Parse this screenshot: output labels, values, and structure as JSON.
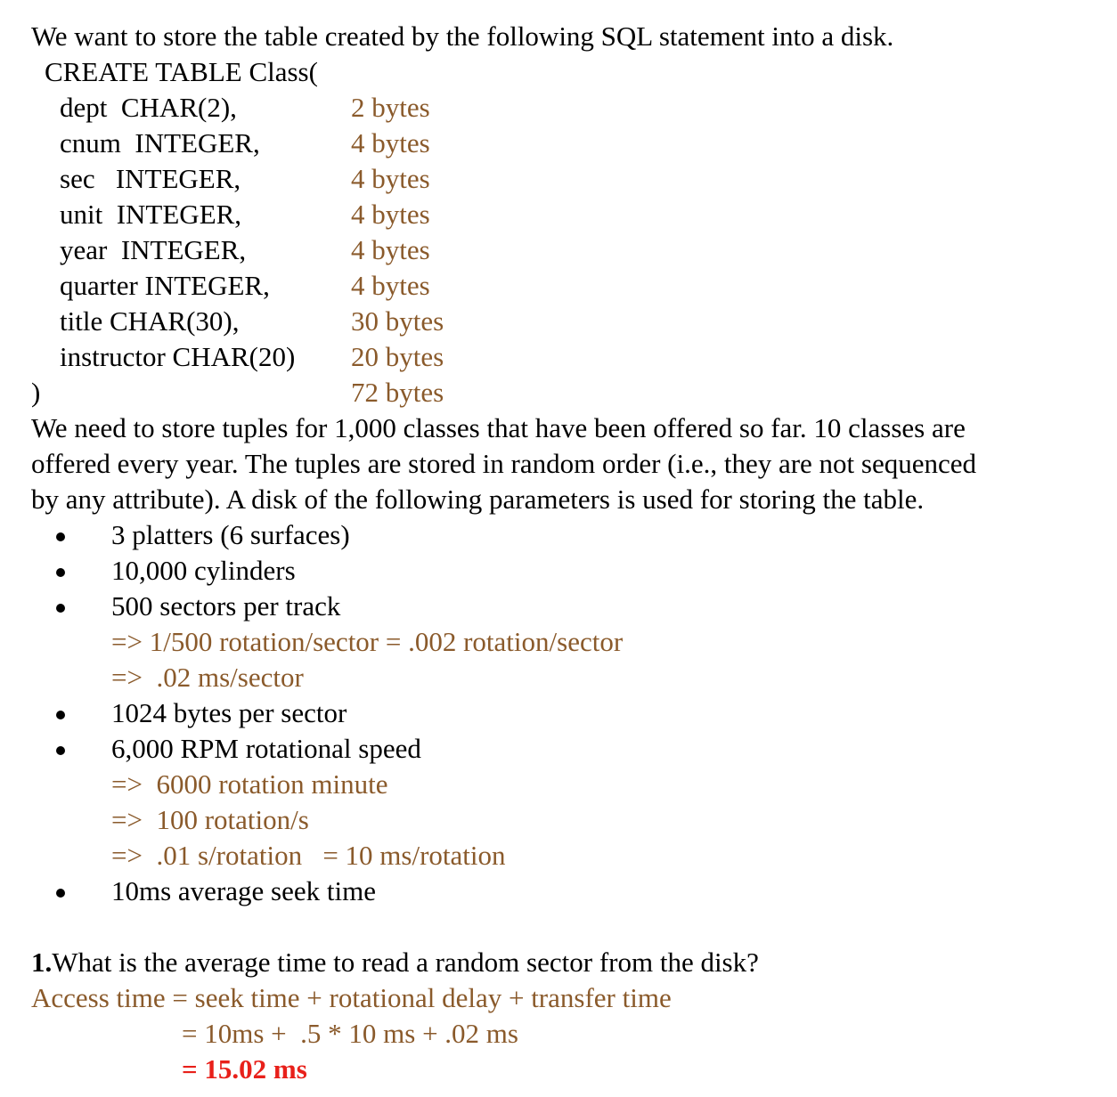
{
  "intro": "We want to store the table created by the following SQL statement into a disk.",
  "create_stmt": "CREATE TABLE Class(",
  "columns": [
    {
      "def": "dept  CHAR(2),",
      "size": "2 bytes"
    },
    {
      "def": "cnum  INTEGER,",
      "size": "4 bytes"
    },
    {
      "def": "sec   INTEGER,",
      "size": "4 bytes"
    },
    {
      "def": "unit  INTEGER,",
      "size": "4 bytes"
    },
    {
      "def": "year  INTEGER,",
      "size": "4 bytes"
    },
    {
      "def": "quarter INTEGER,",
      "size": "4 bytes"
    },
    {
      "def": "title CHAR(30),",
      "size": "30 bytes"
    },
    {
      "def": "instructor CHAR(20)",
      "size": "20 bytes"
    }
  ],
  "close_paren": ")",
  "total": "72 bytes",
  "para": [
    "We need to store tuples for 1,000 classes that have been offered so far. 10 classes are",
    "offered every year. The tuples are stored in random order (i.e., they are not sequenced",
    "by any attribute). A disk of the following parameters is used for storing the table."
  ],
  "bullets": {
    "platters": "3 platters (6 surfaces)",
    "cylinders": "10,000 cylinders",
    "sectors": "500 sectors per track",
    "sectors_note1": "=> 1/500 rotation/sector = .002 rotation/sector",
    "sectors_note2": "=>  .02 ms/sector",
    "bytes": "1024 bytes per sector",
    "rpm": "6,000 RPM rotational speed",
    "rpm_note1": "=>  6000 rotation minute",
    "rpm_note2": "=>  100 rotation/s",
    "rpm_note3": "=>  .01 s/rotation   = 10 ms/rotation",
    "seek": "10ms average seek time"
  },
  "question": {
    "number": "1.",
    "text": "What is the average time to read a random sector from the disk?"
  },
  "answer": {
    "line1": "Access time = seek time + rotational delay + transfer time",
    "line2": "= 10ms +  .5 * 10 ms + .02 ms",
    "line3": "= 15.02 ms"
  }
}
